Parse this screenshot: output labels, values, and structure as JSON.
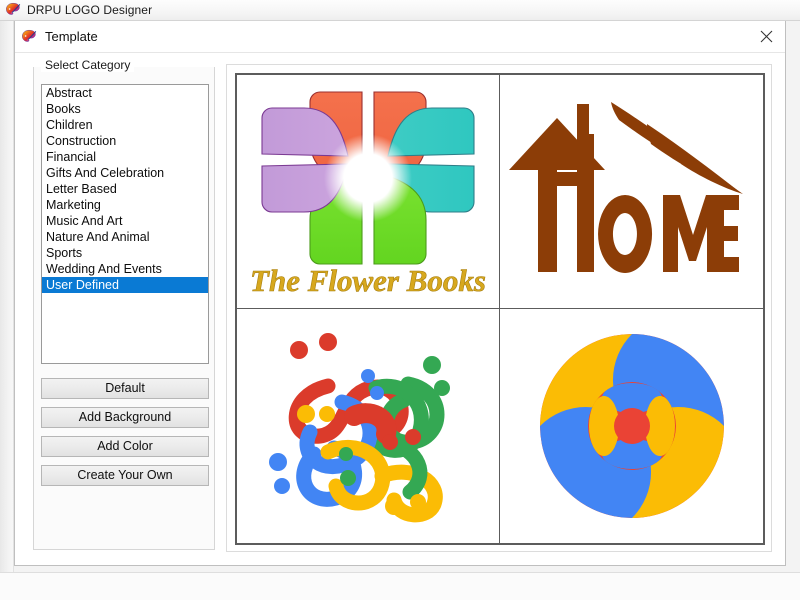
{
  "window": {
    "title": "DRPU LOGO Designer",
    "app_icon": "palette-brush-icon"
  },
  "dialog": {
    "title": "Template",
    "icon": "palette-brush-icon",
    "close_label": "✕"
  },
  "category_panel": {
    "group_label": "Select Category",
    "items": [
      {
        "label": "Abstract",
        "selected": false
      },
      {
        "label": "Books",
        "selected": false
      },
      {
        "label": "Children",
        "selected": false
      },
      {
        "label": "Construction",
        "selected": false
      },
      {
        "label": "Financial",
        "selected": false
      },
      {
        "label": "Gifts And Celebration",
        "selected": false
      },
      {
        "label": "Letter Based",
        "selected": false
      },
      {
        "label": "Marketing",
        "selected": false
      },
      {
        "label": "Music And Art",
        "selected": false
      },
      {
        "label": "Nature And Animal",
        "selected": false
      },
      {
        "label": "Sports",
        "selected": false
      },
      {
        "label": "Wedding And Events",
        "selected": false
      },
      {
        "label": "User Defined",
        "selected": true
      }
    ],
    "selected_value": "User Defined",
    "buttons": {
      "default": "Default",
      "add_background": "Add Background",
      "add_color": "Add Color",
      "create_your_own": "Create Your Own"
    }
  },
  "preview": {
    "columns": 2,
    "rows": 2,
    "logos": [
      {
        "name": "flower-books-logo",
        "caption": "The Flower Books",
        "caption_color": "#D7A81E",
        "petal_colors": [
          "#F26B45",
          "#3ECCC4",
          "#69D92B",
          "#C9A0DC"
        ]
      },
      {
        "name": "home-logo",
        "caption": "HOME",
        "caption_color": "#8C3D07",
        "shape": "house-with-swoosh"
      },
      {
        "name": "celtic-knot-logo",
        "caption": "",
        "ribbon_colors": [
          "#DB3B2B",
          "#4285F4",
          "#34A853",
          "#FBBC05"
        ]
      },
      {
        "name": "mandala-circle-logo",
        "caption": "",
        "circle_colors": [
          "#FBBC05",
          "#4285F4",
          "#EA4335"
        ]
      }
    ]
  },
  "colors": {
    "selection_blue": "#0A7AD4",
    "window_grey": "#F3F3F3",
    "border_grey": "#5C5C5C"
  }
}
